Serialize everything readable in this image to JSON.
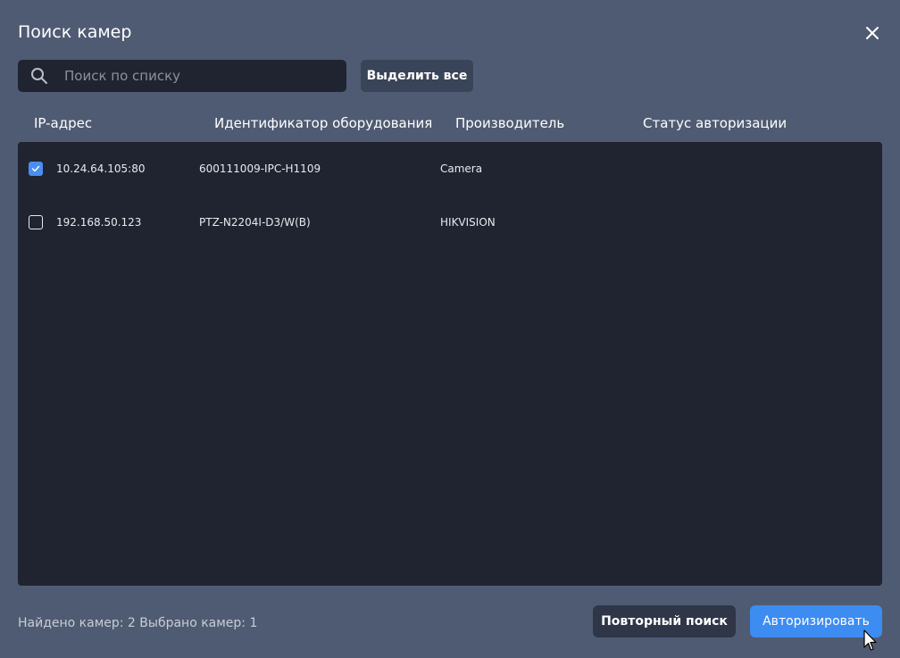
{
  "dialog": {
    "title": "Поиск камер",
    "close_icon": "close-icon"
  },
  "search": {
    "placeholder": "Поиск по списку",
    "value": "",
    "icon": "search-icon"
  },
  "toolbar": {
    "select_all_label": "Выделить все"
  },
  "table": {
    "columns": [
      "IP-адрес",
      "Идентификатор оборудования",
      "Производитель",
      "Статус авторизации"
    ],
    "rows": [
      {
        "checked": true,
        "ip": "10.24.64.105:80",
        "device_id": "600111009-IPC-H1109",
        "vendor": "Camera",
        "auth_status": ""
      },
      {
        "checked": false,
        "ip": "192.168.50.123",
        "device_id": "PTZ-N2204I-D3/W(B)",
        "vendor": "HIKVISION",
        "auth_status": ""
      }
    ]
  },
  "footer": {
    "status_text": "Найдено камер: 2 Выбрано камер: 1",
    "research_label": "Повторный поиск",
    "authorize_label": "Авторизировать"
  },
  "colors": {
    "background": "#4f5b72",
    "panel": "#1f2430",
    "accent": "#3d8cf2",
    "secondary_button": "#2e3648"
  }
}
